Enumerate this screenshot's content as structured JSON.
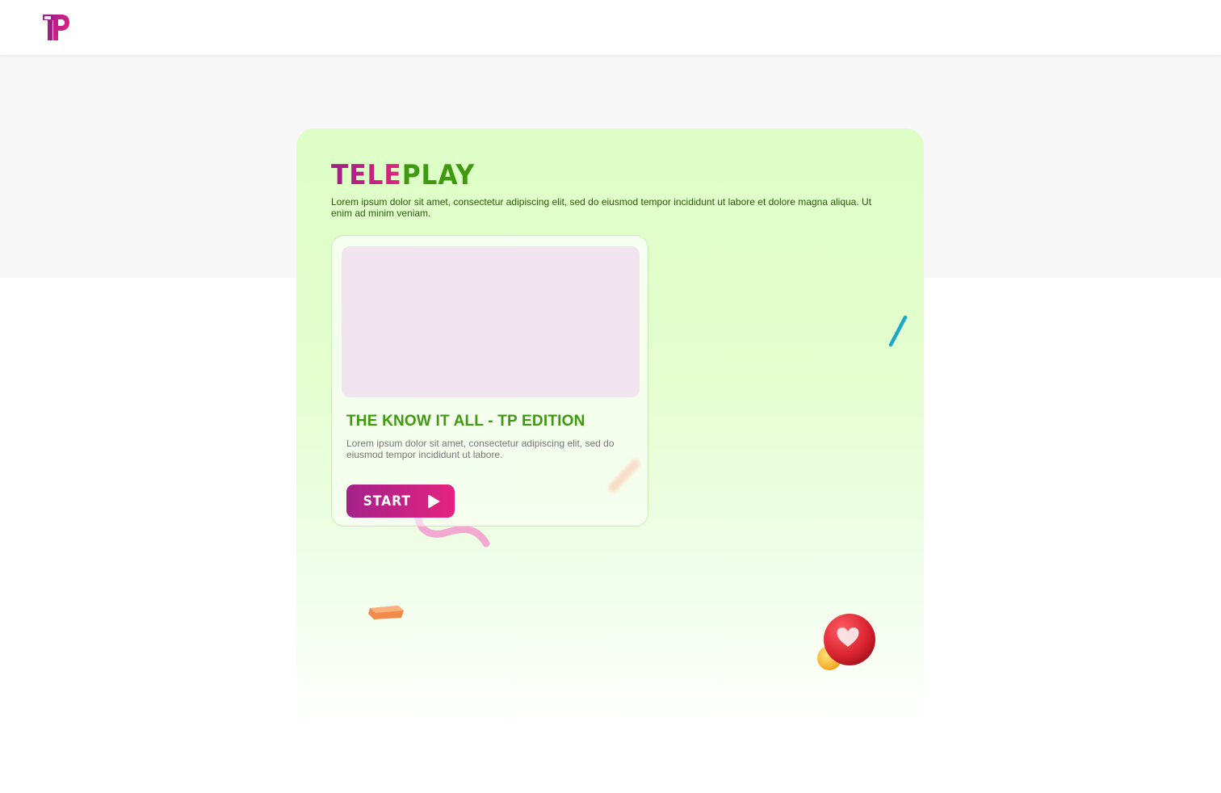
{
  "header": {
    "logo_icon": "tp-brand-logo-icon"
  },
  "hero": {
    "title_part1": "TELE",
    "title_part2": "PLAY",
    "description": "Lorem ipsum dolor sit amet, consectetur adipiscing elit, sed do eiusmod tempor incididunt ut labore et dolore magna aliqua. Ut enim ad minim veniam."
  },
  "game_card": {
    "title": "THE KNOW IT ALL - TP EDITION",
    "description": "Lorem ipsum dolor sit amet, consectetur adipiscing elit, sed do eiusmod tempor incididunt ut labore.",
    "start_label": "START",
    "start_icon": "play-icon"
  },
  "colors": {
    "brand_magenta": "#e32480",
    "brand_purple": "#9d2085",
    "brand_green": "#3f9a10",
    "card_bg": "#ddfec6",
    "thumb_bg": "#f0e5ef"
  }
}
